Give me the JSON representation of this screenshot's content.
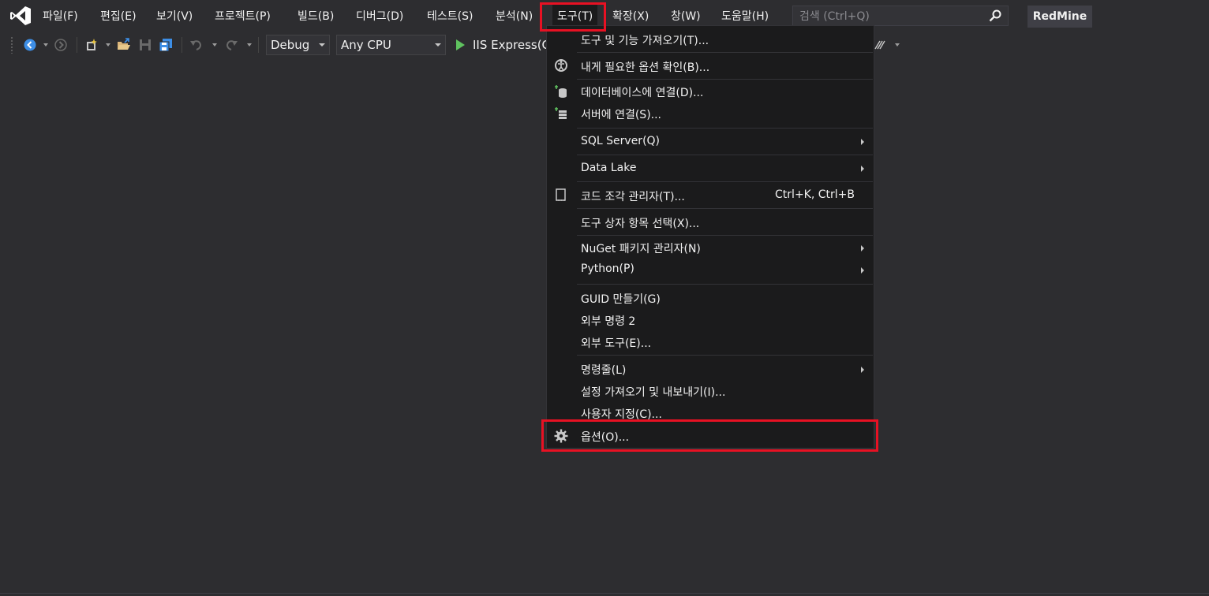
{
  "menubar": {
    "items": [
      "파일(F)",
      "편집(E)",
      "보기(V)",
      "프로젝트(P)",
      "빌드(B)",
      "디버그(D)",
      "테스트(S)",
      "분석(N)",
      "도구(T)",
      "확장(X)",
      "창(W)",
      "도움말(H)"
    ],
    "active_index": 8,
    "search_placeholder": "검색 (Ctrl+Q)",
    "solution_name": "RedMine"
  },
  "toolbar": {
    "configuration": "Debug",
    "platform": "Any CPU",
    "run_label": "IIS Express(Chrome)"
  },
  "tools_menu": {
    "items": [
      {
        "label": "도구 및 기능 가져오기(T)...",
        "icon": "",
        "shortcut": "",
        "submenu": false
      },
      {
        "label": "내게 필요한 옵션 확인(B)...",
        "icon": "accessibility-checker-icon",
        "shortcut": "",
        "submenu": false
      },
      {
        "label": "데이터베이스에 연결(D)...",
        "icon": "connect-database-icon",
        "shortcut": "",
        "submenu": false
      },
      {
        "label": "서버에 연결(S)...",
        "icon": "connect-server-icon",
        "shortcut": "",
        "submenu": false
      },
      {
        "label": "SQL Server(Q)",
        "icon": "",
        "shortcut": "",
        "submenu": true
      },
      {
        "label": "Data Lake",
        "icon": "",
        "shortcut": "",
        "submenu": true
      },
      {
        "label": "코드 조각 관리자(T)...",
        "icon": "code-snippet-icon",
        "shortcut": "Ctrl+K, Ctrl+B",
        "submenu": false
      },
      {
        "label": "도구 상자 항목 선택(X)...",
        "icon": "",
        "shortcut": "",
        "submenu": false
      },
      {
        "label": "NuGet 패키지 관리자(N)",
        "icon": "",
        "shortcut": "",
        "submenu": true
      },
      {
        "label": "Python(P)",
        "icon": "",
        "shortcut": "",
        "submenu": true
      },
      {
        "label": "GUID 만들기(G)",
        "icon": "",
        "shortcut": "",
        "submenu": false
      },
      {
        "label": "외부 명령 2",
        "icon": "",
        "shortcut": "",
        "submenu": false
      },
      {
        "label": "외부 도구(E)...",
        "icon": "",
        "shortcut": "",
        "submenu": false
      },
      {
        "label": "명령줄(L)",
        "icon": "",
        "shortcut": "",
        "submenu": true
      },
      {
        "label": "설정 가져오기 및 내보내기(I)...",
        "icon": "",
        "shortcut": "",
        "submenu": false
      },
      {
        "label": "사용자 지정(C)...",
        "icon": "",
        "shortcut": "",
        "submenu": false
      },
      {
        "label": "옵션(O)...",
        "icon": "gear-icon",
        "shortcut": "",
        "submenu": false
      }
    ]
  },
  "colors": {
    "background": "#2d2d30",
    "menu_background": "#1b1b1c",
    "highlight": "#e81123",
    "text": "#f1f1f1"
  }
}
